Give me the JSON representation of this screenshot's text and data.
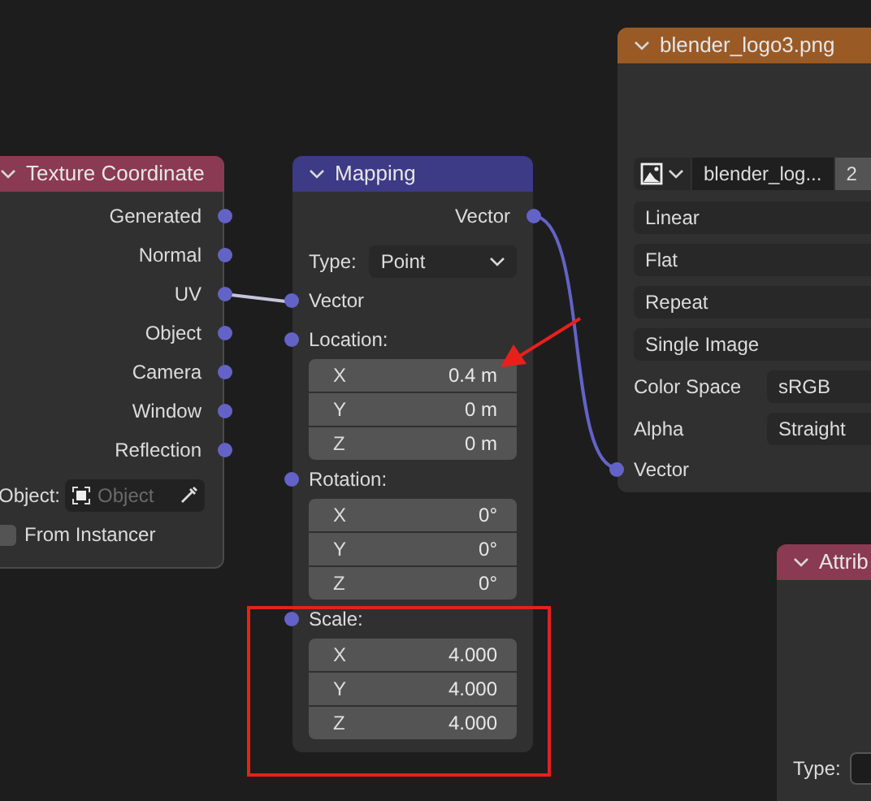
{
  "texture_coordinate": {
    "title": "Texture Coordinate",
    "outputs": [
      "Generated",
      "Normal",
      "UV",
      "Object",
      "Camera",
      "Window",
      "Reflection"
    ],
    "object_label": "Object:",
    "object_placeholder": "Object",
    "from_instancer": {
      "label": "From Instancer",
      "checked": false
    }
  },
  "mapping": {
    "title": "Mapping",
    "output": "Vector",
    "type_label": "Type:",
    "type_value": "Point",
    "input": "Vector",
    "groups": [
      {
        "label": "Location:",
        "fields": [
          {
            "axis": "X",
            "value": "0.4 m"
          },
          {
            "axis": "Y",
            "value": "0 m"
          },
          {
            "axis": "Z",
            "value": "0 m"
          }
        ]
      },
      {
        "label": "Rotation:",
        "fields": [
          {
            "axis": "X",
            "value": "0°"
          },
          {
            "axis": "Y",
            "value": "0°"
          },
          {
            "axis": "Z",
            "value": "0°"
          }
        ]
      },
      {
        "label": "Scale:",
        "fields": [
          {
            "axis": "X",
            "value": "4.000"
          },
          {
            "axis": "Y",
            "value": "4.000"
          },
          {
            "axis": "Z",
            "value": "4.000"
          }
        ]
      }
    ]
  },
  "image_texture": {
    "title": "blender_logo3.png",
    "image_name": "blender_log...",
    "users": "2",
    "dropdowns": [
      "Linear",
      "Flat",
      "Repeat",
      "Single Image"
    ],
    "properties": [
      {
        "label": "Color Space",
        "value": "sRGB"
      },
      {
        "label": "Alpha",
        "value": "Straight"
      }
    ],
    "input": "Vector"
  },
  "attribute": {
    "title": "Attrib",
    "type_label": "Type:"
  }
}
